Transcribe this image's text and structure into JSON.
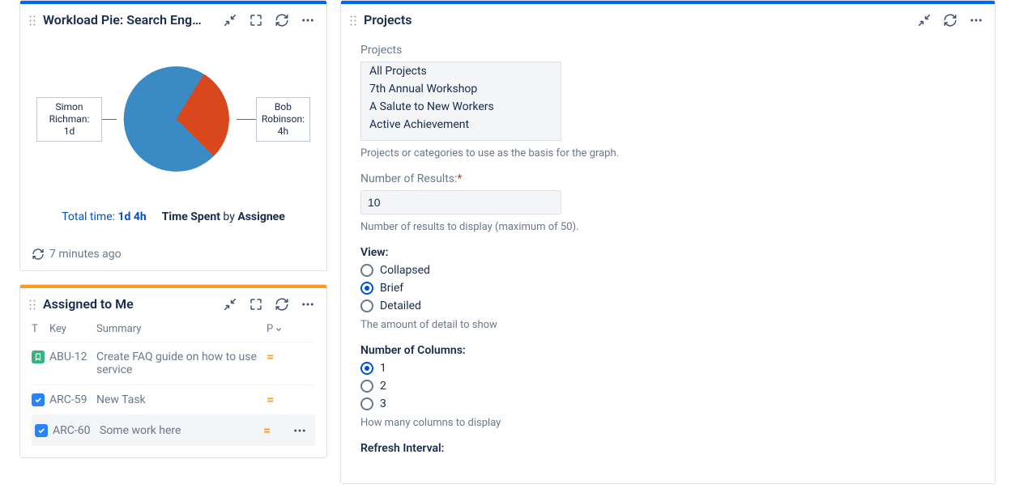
{
  "chart_data": {
    "type": "pie",
    "title": "Workload Pie: Search Eng…",
    "series": [
      {
        "name": "Simon Richman",
        "label": "Simon Richman: 1d",
        "hours": 24,
        "color": "#3a8ac3"
      },
      {
        "name": "Bob Robinson",
        "label": "Bob Robinson: 4h",
        "hours": 4,
        "color": "#d9481c"
      }
    ],
    "total_label": "Total time:",
    "total_value": "1d 4h",
    "metric_label": "Time Spent",
    "by_label": "by",
    "dimension_label": "Assignee"
  },
  "workload_pie": {
    "refresh_ago": "7 minutes ago"
  },
  "assigned": {
    "title": "Assigned to Me",
    "columns": {
      "t": "T",
      "key": "Key",
      "summary": "Summary",
      "p": "P"
    },
    "rows": [
      {
        "type": "story",
        "key": "ABU-12",
        "summary": "Create FAQ guide on how to use service",
        "priority": "medium"
      },
      {
        "type": "task",
        "key": "ARC-59",
        "summary": "New Task",
        "priority": "medium"
      },
      {
        "type": "task",
        "key": "ARC-60",
        "summary": "Some work here",
        "priority": "medium"
      }
    ]
  },
  "projects_gadget": {
    "title": "Projects",
    "projects_label": "Projects",
    "options": [
      "All Projects",
      "7th Annual Workshop",
      "A Salute to New Workers",
      "Active Achievement"
    ],
    "projects_help": "Projects or categories to use as the basis for the graph.",
    "num_results_label": "Number of Results:",
    "num_results_value": "10",
    "num_results_help": "Number of results to display (maximum of 50).",
    "view_label": "View:",
    "view_options": [
      "Collapsed",
      "Brief",
      "Detailed"
    ],
    "view_selected": "Brief",
    "view_help": "The amount of detail to show",
    "cols_label": "Number of Columns:",
    "cols_options": [
      "1",
      "2",
      "3"
    ],
    "cols_selected": "1",
    "cols_help": "How many columns to display",
    "refresh_label": "Refresh Interval:"
  }
}
